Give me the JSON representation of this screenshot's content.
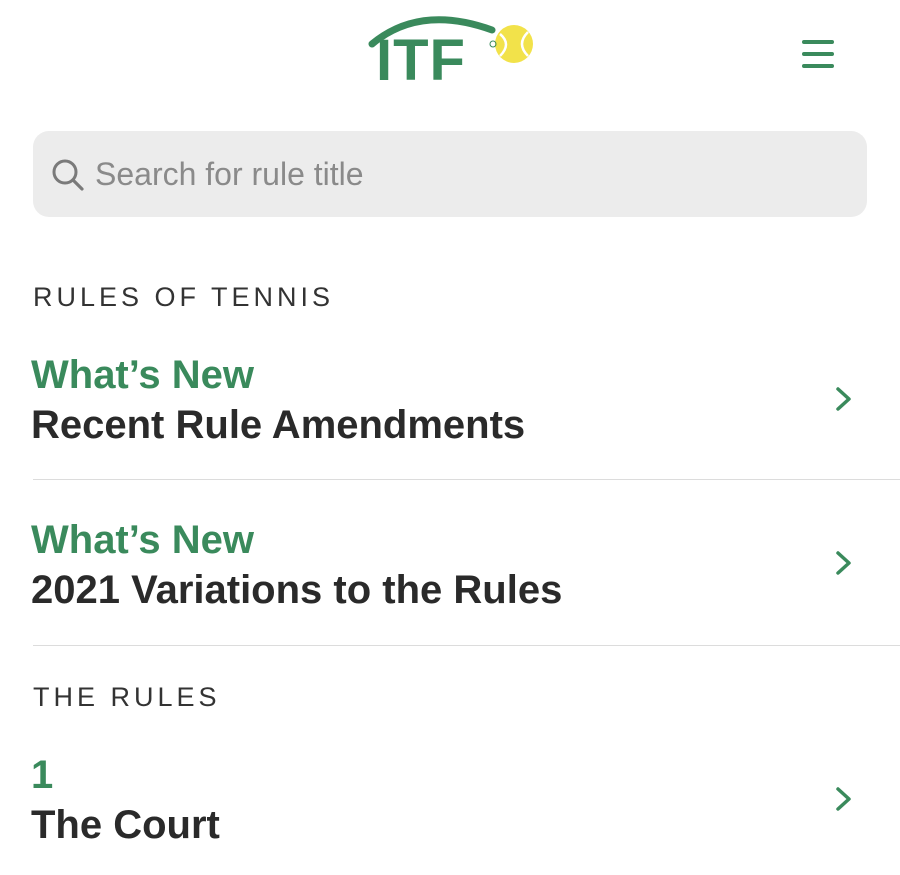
{
  "header": {
    "logo_text": "ITF",
    "brand_color": "#3a8a5c",
    "ball_color": "#f2e24a",
    "menu_icon": "hamburger-menu-icon"
  },
  "search": {
    "placeholder": "Search for rule title",
    "value": "",
    "icon": "search-icon"
  },
  "sections": [
    {
      "label": "RULES OF TENNIS",
      "items": [
        {
          "kicker": "What’s New",
          "title": "Recent Rule Amendments"
        },
        {
          "kicker": "What’s New",
          "title": "2021 Variations to the Rules"
        }
      ]
    },
    {
      "label": "THE RULES",
      "items": [
        {
          "kicker": "1",
          "title": "The Court"
        }
      ]
    }
  ],
  "colors": {
    "accent": "#3a8a5c",
    "text": "#2a2a2a",
    "search_bg": "#ececec",
    "divider": "#dcdcdc"
  }
}
